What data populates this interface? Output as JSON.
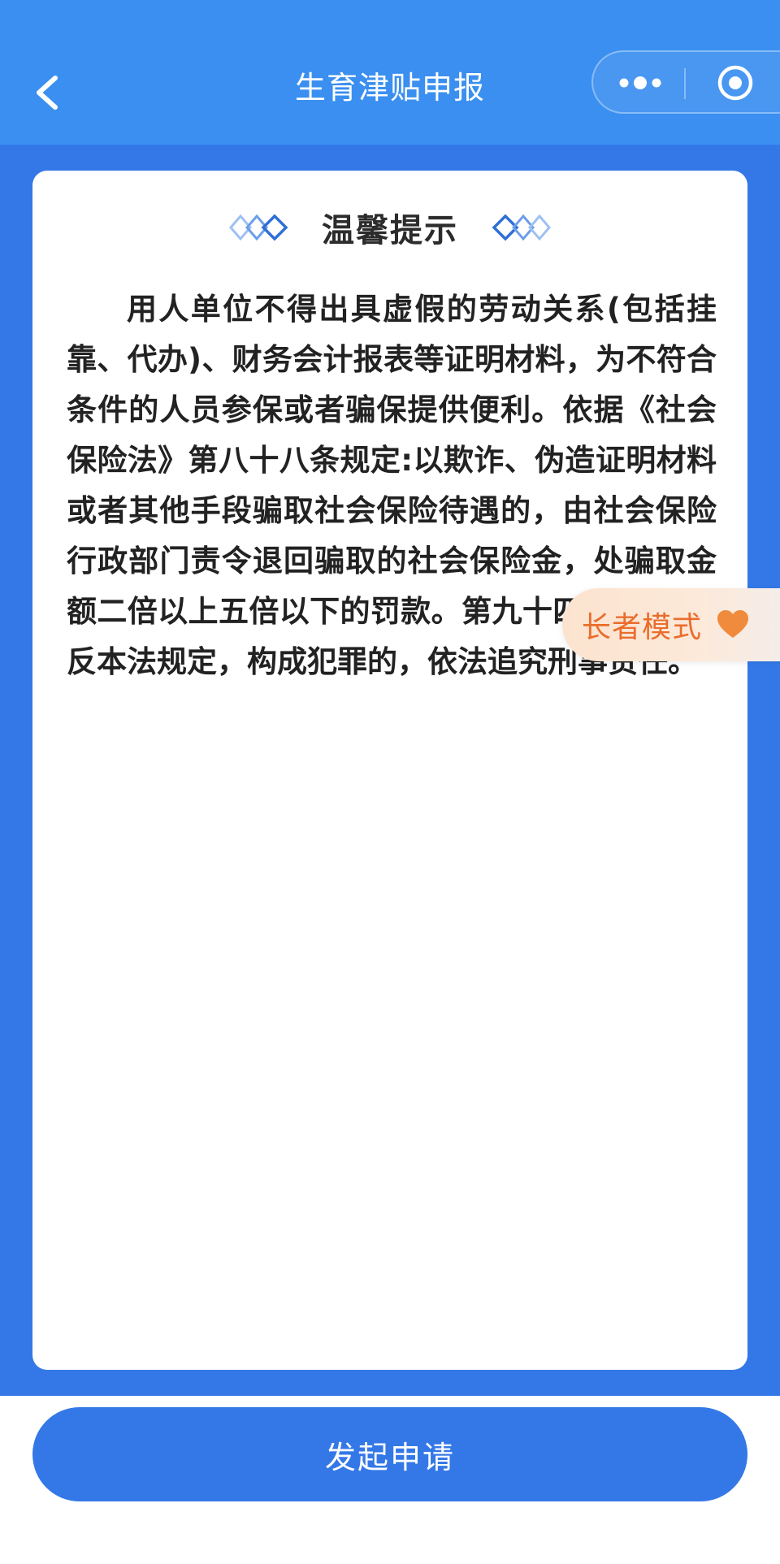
{
  "header": {
    "title": "生育津贴申报",
    "back_icon": "chevron-left-icon",
    "more_icon": "more-dots-icon",
    "close_icon": "close-target-icon"
  },
  "card": {
    "title": "温馨提示",
    "notice_text": "用人单位不得出具虚假的劳动关系(包括挂靠、代办)、财务会计报表等证明材料，为不符合条件的人员参保或者骗保提供便利。依据《社会保险法》第八十八条规定:以欺诈、伪造证明材料或者其他手段骗取社会保险待遇的，由社会保险行政部门责令退回骗取的社会保险金，处骗取金额二倍以上五倍以下的罚款。第九十四条规定:违反本法规定，构成犯罪的，依法追究刑事责任。"
  },
  "elder_mode": {
    "label": "长者模式",
    "icon": "heart-icon"
  },
  "footer": {
    "submit_label": "发起申请"
  },
  "colors": {
    "header_bg": "#3a8ff0",
    "page_bg": "#3478e8",
    "button_bg": "#3478e8",
    "elder_text": "#ea6d2c",
    "heart": "#f08a3c"
  }
}
